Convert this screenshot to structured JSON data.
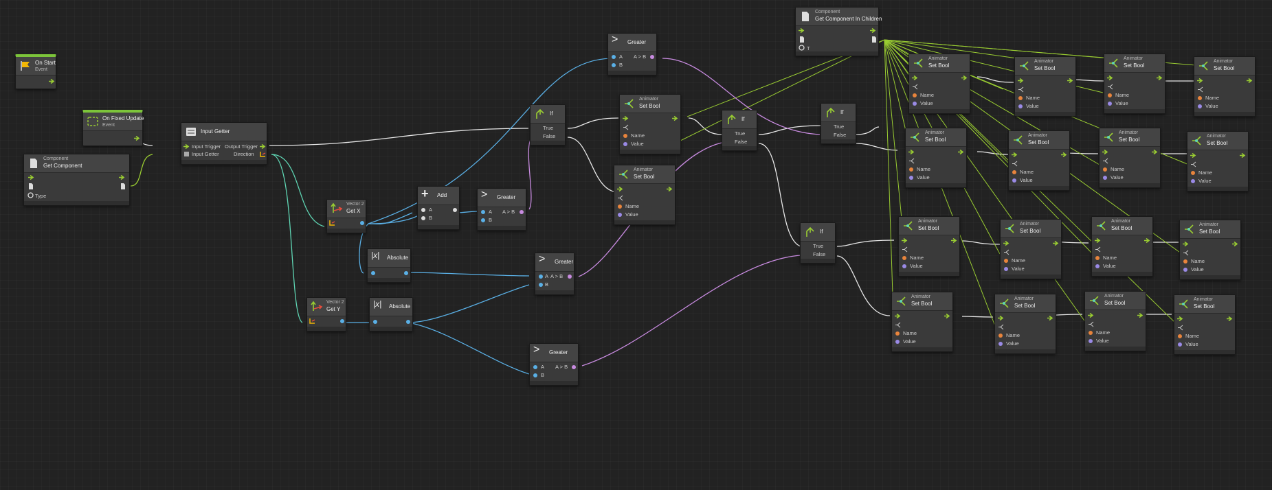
{
  "graph": {
    "accent_color": "#9acd32",
    "nodes": {
      "on_start": {
        "title": "On Start",
        "category": "Event"
      },
      "on_fixed_update": {
        "title": "On Fixed Update",
        "category": "Event"
      },
      "get_component": {
        "category": "Component",
        "title": "Get Component",
        "port_type": "Type"
      },
      "input_getter": {
        "title": "Input Getter",
        "in1": "Input Trigger",
        "in2": "Input Getter",
        "out1": "Output Trigger",
        "out2": "Direction"
      },
      "get_x": {
        "category": "Vector 2",
        "title": "Get X"
      },
      "get_y": {
        "category": "Vector 2",
        "title": "Get Y"
      },
      "abs1": {
        "title": "Absolute"
      },
      "abs2": {
        "title": "Absolute"
      },
      "add": {
        "title": "Add",
        "a": "A",
        "b": "B"
      },
      "greater1": {
        "title": "Greater",
        "a": "A",
        "b": "B",
        "out": "A > B"
      },
      "greater_mid": {
        "title": "Greater",
        "a": "A",
        "b": "B",
        "out": "A > B"
      },
      "greater_top": {
        "title": "Greater",
        "a": "A",
        "b": "B",
        "out": "A > B"
      },
      "greater_bot": {
        "title": "Greater",
        "a": "A",
        "b": "B",
        "out": "A > B"
      },
      "get_comp_children": {
        "category": "Component",
        "title": "Get Component In Children",
        "port_type": "T"
      },
      "if_label": "If",
      "true_label": "True",
      "false_label": "False",
      "animator_category": "Animator",
      "set_bool_title": "Set Bool",
      "name_label": "Name",
      "value_label": "Value"
    }
  }
}
